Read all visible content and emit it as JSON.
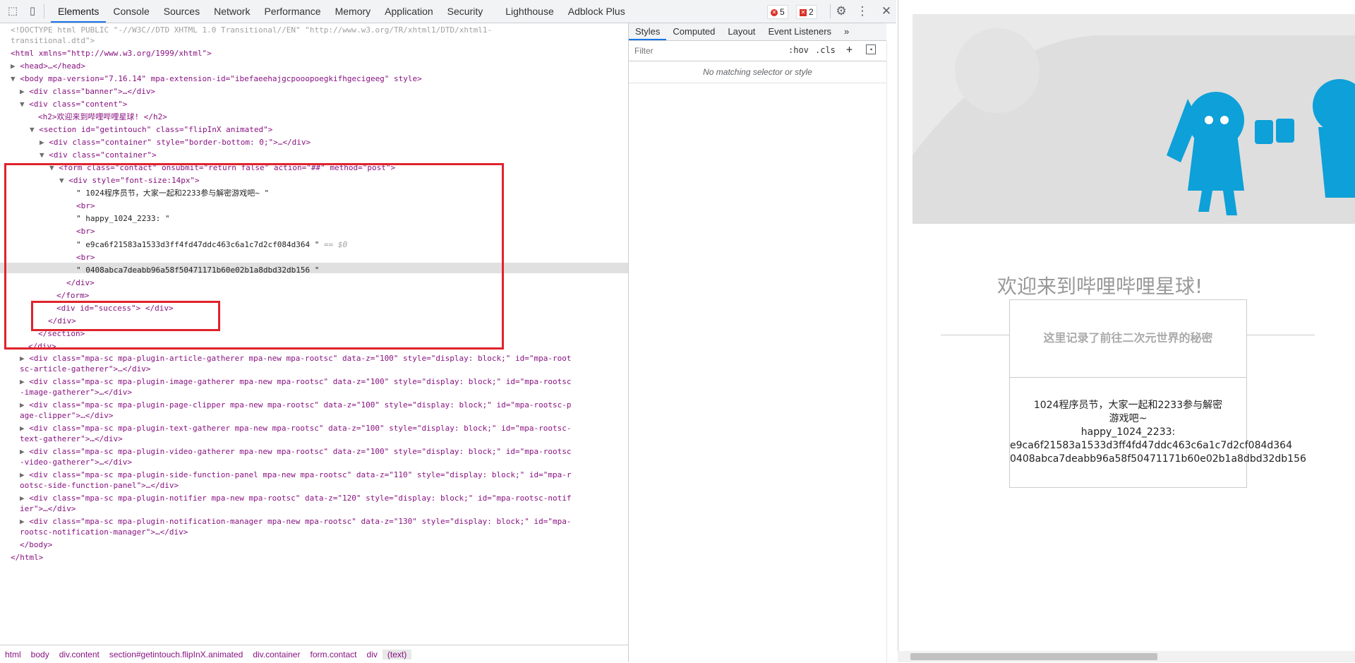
{
  "devtools": {
    "tabs": [
      "Elements",
      "Console",
      "Sources",
      "Network",
      "Performance",
      "Memory",
      "Application",
      "Security",
      "Lighthouse",
      "Adblock Plus"
    ],
    "errors_count": "5",
    "issues_count": "2"
  },
  "dom": {
    "l0a": "<!DOCTYPE html PUBLIC \"-//W3C//DTD XHTML 1.0 Transitional//EN\" \"http://www.w3.org/TR/xhtml1/DTD/xhtml1-",
    "l0b": "transitional.dtd\">",
    "l1": "<html xmlns=\"http://www.w3.org/1999/xhtml\">",
    "l2": "<head>…</head>",
    "l3": "<body mpa-version=\"7.16.14\" mpa-extension-id=\"ibefaeehajgcpooopoegkifhgecigeeg\" style>",
    "l4": "<div class=\"banner\">…</div>",
    "l5": "<div class=\"content\">",
    "l6": "<h2>欢迎来到哔哩哔哩星球! </h2>",
    "l7": "<section id=\"getintouch\" class=\"flipInX animated\">",
    "l8": "<div class=\"container\" style=\"border-bottom: 0;\">…</div>",
    "l9": "<div class=\"container\">",
    "l10": "<form class=\"contact\" onsubmit=\"return false\" action=\"##\" method=\"post\">",
    "l11": "<div style=\"font-size:14px\">",
    "l12": "\" 1024程序员节，大家一起和2233参与解密游戏吧~ \"",
    "l13": "<br>",
    "l14": "\" happy_1024_2233: \"",
    "l15": "<br>",
    "l16": "\" e9ca6f21583a1533d3ff4fd47ddc463c6a1c7d2cf084d364 \"",
    "l16b": "== $0",
    "l17": "<br>",
    "l18": "\" 0408abca7deabb96a58f50471171b60e02b1a8dbd32db156 \"",
    "l19": "</div>",
    "l20": "</form>",
    "l21": "<div id=\"success\"> </div>",
    "l22": "</div>",
    "l23": "</section>",
    "l24": "</div>",
    "l25a": "<div class=\"mpa-sc mpa-plugin-article-gatherer mpa-new mpa-rootsc\" data-z=\"100\" style=\"display: block;\" id=\"mpa-root",
    "l25b": "sc-article-gatherer\">…</div>",
    "l26a": "<div class=\"mpa-sc mpa-plugin-image-gatherer mpa-new mpa-rootsc\" data-z=\"100\" style=\"display: block;\" id=\"mpa-rootsc",
    "l26b": "-image-gatherer\">…</div>",
    "l27a": "<div class=\"mpa-sc mpa-plugin-page-clipper mpa-new mpa-rootsc\" data-z=\"100\" style=\"display: block;\" id=\"mpa-rootsc-p",
    "l27b": "age-clipper\">…</div>",
    "l28a": "<div class=\"mpa-sc mpa-plugin-text-gatherer mpa-new mpa-rootsc\" data-z=\"100\" style=\"display: block;\" id=\"mpa-rootsc-",
    "l28b": "text-gatherer\">…</div>",
    "l29a": "<div class=\"mpa-sc mpa-plugin-video-gatherer mpa-new mpa-rootsc\" data-z=\"100\" style=\"display: block;\" id=\"mpa-rootsc",
    "l29b": "-video-gatherer\">…</div>",
    "l30a": "<div class=\"mpa-sc mpa-plugin-side-function-panel mpa-new mpa-rootsc\" data-z=\"110\" style=\"display: block;\" id=\"mpa-r",
    "l30b": "ootsc-side-function-panel\">…</div>",
    "l31a": "<div class=\"mpa-sc mpa-plugin-notifier mpa-new mpa-rootsc\" data-z=\"120\" style=\"display: block;\" id=\"mpa-rootsc-notif",
    "l31b": "ier\">…</div>",
    "l32a": "<div class=\"mpa-sc mpa-plugin-notification-manager mpa-new mpa-rootsc\" data-z=\"130\" style=\"display: block;\" id=\"mpa-",
    "l32b": "rootsc-notification-manager\">…</div>",
    "l33": "</body>",
    "l34": "</html>"
  },
  "breadcrumb": [
    "html",
    "body",
    "div.content",
    "section#getintouch.flipInX.animated",
    "div.container",
    "form.contact",
    "div",
    "(text)"
  ],
  "styles": {
    "tabs": [
      "Styles",
      "Computed",
      "Layout",
      "Event Listeners",
      "»"
    ],
    "filter_placeholder": "Filter",
    "hov": ":hov",
    "cls": ".cls",
    "plus": "+",
    "no_match": "No matching selector or style"
  },
  "page": {
    "welcome": "欢迎来到哔哩哔哩星球!",
    "secret": "这里记录了前往二次元世界的秘密",
    "msg1": "1024程序员节，大家一起和2233参与解密",
    "msg2": "游戏吧~",
    "msg3": "happy_1024_2233:",
    "msg4": "e9ca6f21583a1533d3ff4fd47ddc463c6a1c7d2cf084d364",
    "msg5": "0408abca7deabb96a58f50471171b60e02b1a8dbd32db156"
  },
  "colors": {
    "accent": "#1a73e8",
    "highlight_box": "#e0232c",
    "tag": "#881280",
    "attr": "#994500",
    "value": "#1a1aa6"
  }
}
